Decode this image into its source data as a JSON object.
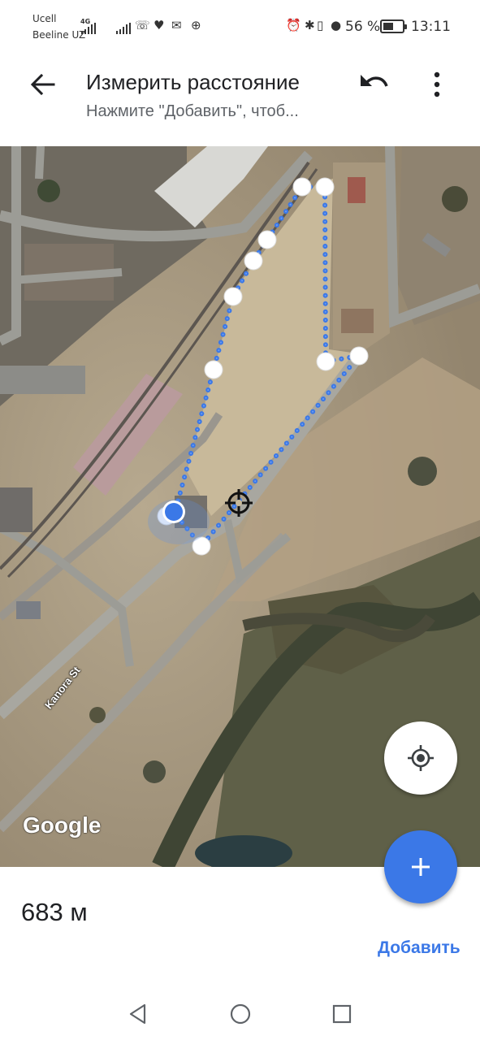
{
  "status_bar": {
    "carrier_1": "Ucell",
    "carrier_2": "Beeline UZ",
    "network_tag": "4G",
    "battery_percent_text": "56 %",
    "battery_level": 0.56,
    "time": "13:11",
    "icons": [
      "signal-icon",
      "missed-call-icon",
      "health-icon",
      "voicemail-icon",
      "messenger-icon",
      "alarm-icon",
      "bluetooth-icon",
      "vibrate-icon",
      "location-icon",
      "battery-icon"
    ]
  },
  "app_bar": {
    "title": "Измерить расстояние",
    "subtitle": "Нажмите \"Добавить\", чтоб...",
    "back_icon": "arrow-back-icon",
    "undo_icon": "undo-icon",
    "menu_icon": "more-vert-icon"
  },
  "map": {
    "street_label": "Kanora St",
    "logo_text": "Google",
    "measure_color": "#3b78e7",
    "locate_icon": "my-location-icon",
    "add_icon": "plus-icon"
  },
  "panel": {
    "distance": "683 м",
    "add_label": "Добавить"
  },
  "nav_bar": {
    "icons": [
      "nav-back-icon",
      "nav-home-icon",
      "nav-recents-icon"
    ]
  }
}
